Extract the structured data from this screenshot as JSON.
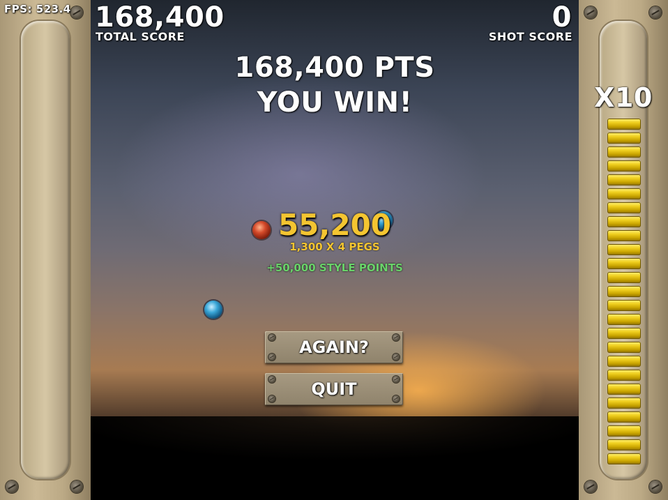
{
  "hud": {
    "fps": "FPS: 523.4",
    "total_score_value": "168,400",
    "total_score_label": "TOTAL SCORE",
    "shot_score_value": "0",
    "shot_score_label": "SHOT SCORE",
    "multiplier": "X10"
  },
  "result": {
    "points_line": "168,400 PTS",
    "win_line": "YOU WIN!",
    "shot_points": "55,200",
    "shot_detail": "1,300 X 4 PEGS",
    "style_points": "+50,000 STYLE POINTS"
  },
  "buttons": {
    "again": "AGAIN?",
    "quit": "QUIT"
  },
  "meter": {
    "filled_segments": 25,
    "total_segments": 25
  },
  "colors": {
    "score_gold": "#f4c531",
    "style_green": "#6ad36a",
    "meter_gold": "#f0d020"
  }
}
